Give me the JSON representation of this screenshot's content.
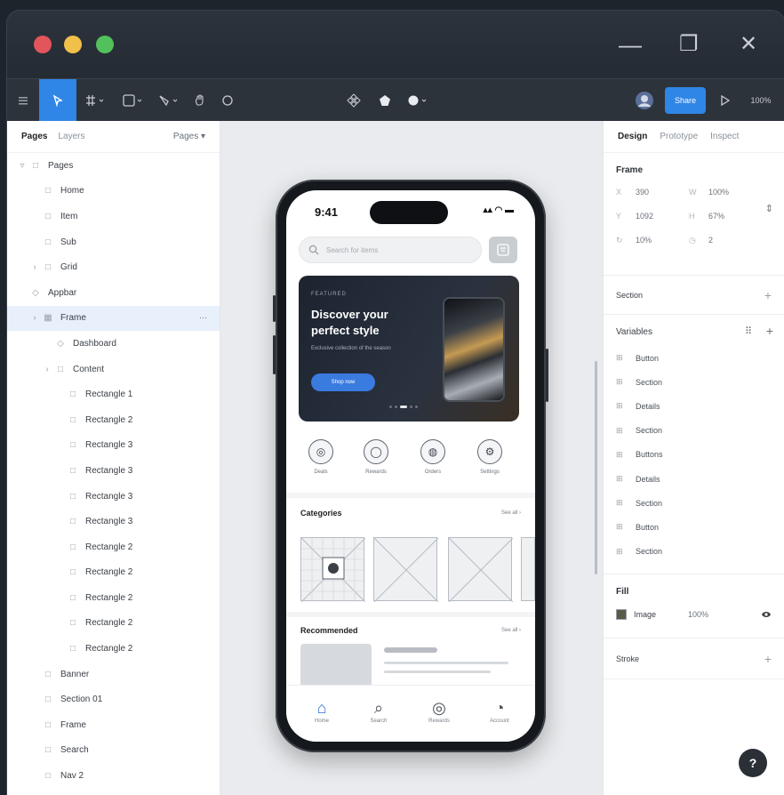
{
  "window": {
    "minimize_glyph": "—",
    "restore_glyph": "❐",
    "close_glyph": "✕"
  },
  "toolbar": {
    "share_label": "Share",
    "zoom_label": "100%"
  },
  "left_panel": {
    "tab_pages": "Pages",
    "tab_layers": "Layers",
    "page_dropdown": "Pages ▾",
    "layers": [
      {
        "label": "Pages",
        "indent": 0,
        "icon": "□",
        "arrow": "▿"
      },
      {
        "label": "Home",
        "indent": 1,
        "icon": "□",
        "arrow": ""
      },
      {
        "label": "Item",
        "indent": 1,
        "icon": "□",
        "arrow": ""
      },
      {
        "label": "Sub",
        "indent": 1,
        "icon": "□",
        "arrow": ""
      },
      {
        "label": "Grid",
        "indent": 1,
        "icon": "□",
        "arrow": "›"
      },
      {
        "label": "Appbar",
        "indent": 0,
        "icon": "◇",
        "arrow": ""
      },
      {
        "label": "Frame",
        "indent": 1,
        "icon": "▦",
        "arrow": "›",
        "selected": true
      },
      {
        "label": "Dashboard",
        "indent": 2,
        "icon": "◇",
        "arrow": ""
      },
      {
        "label": "Content",
        "indent": 2,
        "icon": "□",
        "arrow": "›"
      },
      {
        "label": "Rectangle 1",
        "indent": 3,
        "icon": "□",
        "arrow": ""
      },
      {
        "label": "Rectangle 2",
        "indent": 3,
        "icon": "□",
        "arrow": ""
      },
      {
        "label": "Rectangle 3",
        "indent": 3,
        "icon": "□",
        "arrow": ""
      },
      {
        "label": "Rectangle 3",
        "indent": 3,
        "icon": "□",
        "arrow": ""
      },
      {
        "label": "Rectangle 3",
        "indent": 3,
        "icon": "□",
        "arrow": ""
      },
      {
        "label": "Rectangle 3",
        "indent": 3,
        "icon": "□",
        "arrow": ""
      },
      {
        "label": "Rectangle 2",
        "indent": 3,
        "icon": "□",
        "arrow": ""
      },
      {
        "label": "Rectangle 2",
        "indent": 3,
        "icon": "□",
        "arrow": ""
      },
      {
        "label": "Rectangle 2",
        "indent": 3,
        "icon": "□",
        "arrow": ""
      },
      {
        "label": "Rectangle 2",
        "indent": 3,
        "icon": "□",
        "arrow": ""
      },
      {
        "label": "Rectangle 2",
        "indent": 3,
        "icon": "□",
        "arrow": ""
      },
      {
        "label": "Banner",
        "indent": 1,
        "icon": "□",
        "arrow": ""
      },
      {
        "label": "Section 01",
        "indent": 1,
        "icon": "□",
        "arrow": ""
      },
      {
        "label": "Frame",
        "indent": 1,
        "icon": "□",
        "arrow": ""
      },
      {
        "label": "Search",
        "indent": 1,
        "icon": "□",
        "arrow": ""
      },
      {
        "label": "Nav 2",
        "indent": 1,
        "icon": "□",
        "arrow": ""
      }
    ]
  },
  "phone": {
    "time": "9:41",
    "status_icons": "▴▴ ◠ ▬",
    "search_placeholder": "Search for items",
    "banner_kicker": "FEATURED",
    "banner_title_1": "Discover your",
    "banner_title_2": "perfect style",
    "banner_body": "Exclusive collection of the season",
    "banner_button": "Shop now",
    "quick_actions": [
      {
        "label": "Deals",
        "glyph": "◎"
      },
      {
        "label": "Rewards",
        "glyph": "◯"
      },
      {
        "label": "Orders",
        "glyph": "◍"
      },
      {
        "label": "Settings",
        "glyph": "⚙"
      }
    ],
    "section1_title": "Categories",
    "section1_see_all": "See all ›",
    "section2_title": "Recommended",
    "section2_see_all": "See all ›",
    "nav": [
      {
        "label": "Home",
        "glyph": "⌂"
      },
      {
        "label": "Search",
        "glyph": "⌕"
      },
      {
        "label": "Rewards",
        "glyph": "◎"
      },
      {
        "label": "Account",
        "glyph": "◔"
      }
    ]
  },
  "right_panel": {
    "tab_design": "Design",
    "tab_prototype": "Prototype",
    "tab_inspect": "Inspect",
    "frame_title": "Frame",
    "frame_props": [
      {
        "label": "X",
        "value": "390"
      },
      {
        "label": "W",
        "value": "100%"
      },
      {
        "label": "Y",
        "value": "1092"
      },
      {
        "label": "H",
        "value": "67%"
      },
      {
        "label": "↻",
        "value": "10%"
      },
      {
        "label": "◷",
        "value": "2"
      }
    ],
    "section_label": "Section",
    "variables_title": "Variables",
    "variables": [
      "Button",
      "Section",
      "Details",
      "Section",
      "Buttons",
      "Details",
      "Section",
      "Button",
      "Section"
    ],
    "fill_title": "Fill",
    "fill_label": "Image",
    "fill_value": "100%",
    "stroke_label": "Stroke",
    "help_label": "?"
  },
  "colors": {
    "accent": "#2f86e6",
    "traffic_red": "#e2555a",
    "traffic_yellow": "#f1c04a",
    "traffic_green": "#52c15b",
    "cta": "#3a7be0"
  }
}
